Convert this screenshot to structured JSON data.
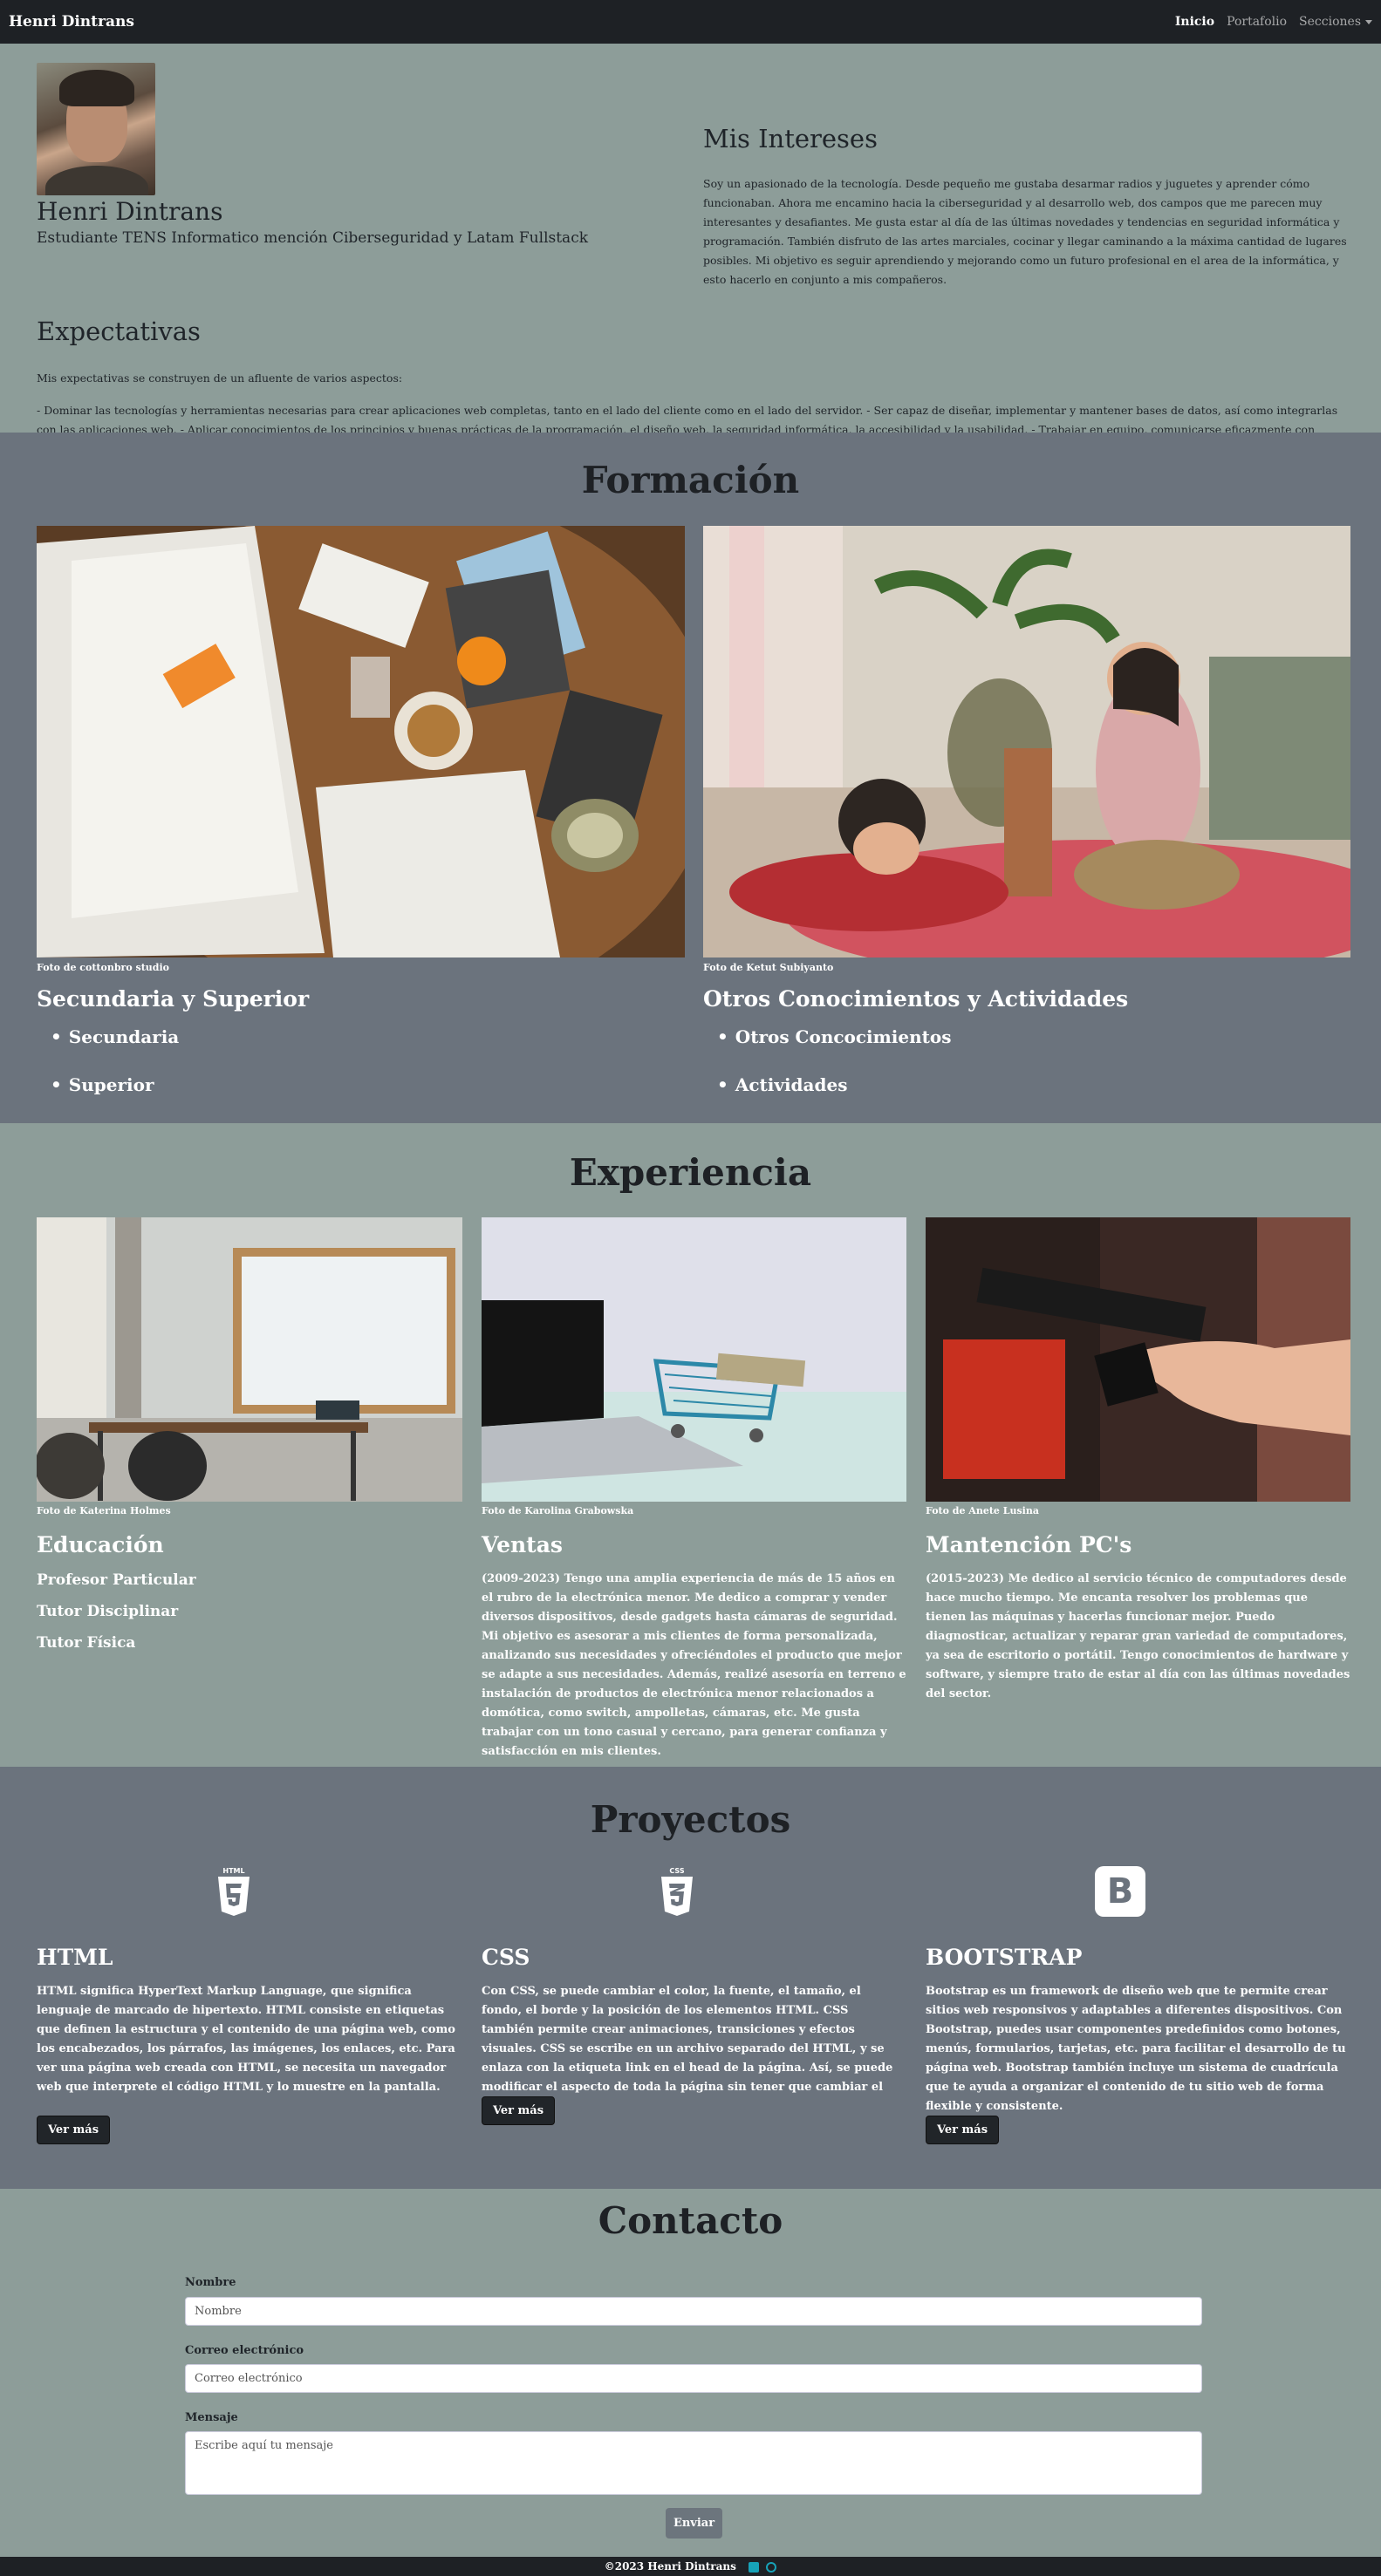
{
  "nav": {
    "brand": "Henri Dintrans",
    "links": [
      {
        "label": "Inicio",
        "active": true
      },
      {
        "label": "Portafolio",
        "active": false
      },
      {
        "label": "Secciones",
        "active": false
      }
    ]
  },
  "about": {
    "name": "Henri Dintrans",
    "subtitle": "Estudiante TENS Informatico mención Ciberseguridad y Latam Fullstack",
    "expect_title": "Expectativas",
    "expect_intro": "Mis expectativas se construyen de un afluente de varios aspectos:",
    "expect_body": "- Dominar las tecnologías y herramientas necesarias para crear aplicaciones web completas, tanto en el lado del cliente como en el lado del servidor. - Ser capaz de diseñar, implementar y mantener bases de datos, así como integrarlas con las aplicaciones web. - Aplicar conocimientos de los principios y buenas prácticas de la programación, el diseño web, la seguridad informática, la accesibilidad y la usabilidad. - Trabajar en equipo, comunicarse eficazmente con otros desarrolladores y clientes, y adaptarse a los cambios y requerimientos del proyecto. - Estar al día de las tendencias, novedades y oportunidades del sector, así como de las necesidades y preferencias de los usuarios.",
    "interests_title": "Mis Intereses",
    "interests_body": "Soy un apasionado de la tecnología. Desde pequeño me gustaba desarmar radios y juguetes y aprender cómo funcionaban. Ahora me encamino hacia la ciberseguridad y al desarrollo web, dos campos que me parecen muy interesantes y desafiantes. Me gusta estar al día de las últimas novedades y tendencias en seguridad informática y programación. También disfruto de las artes marciales, cocinar y llegar caminando a la máxima cantidad de lugares posibles. Mi objetivo es seguir aprendiendo y mejorando como un futuro profesional en el area de la informática, y esto hacerlo en conjunto a mis compañeros."
  },
  "formacion": {
    "title": "Formación",
    "cards": [
      {
        "credit": "Foto de cottonbro studio",
        "title": "Secundaria y Superior",
        "items": [
          "Secundaria",
          "Superior"
        ]
      },
      {
        "credit": "Foto de Ketut Subiyanto",
        "title": "Otros Conocimientos y Actividades",
        "items": [
          "Otros Concocimientos",
          "Actividades"
        ]
      }
    ]
  },
  "experiencia": {
    "title": "Experiencia",
    "cards": [
      {
        "credit": "Foto de Katerina Holmes",
        "title": "Educación",
        "items": [
          "Profesor Particular",
          "Tutor Disciplinar",
          "Tutor Física"
        ]
      },
      {
        "credit": "Foto de Karolina Grabowska",
        "title": "Ventas",
        "body": "(2009-2023) Tengo una amplia experiencia de más de 15 años en el rubro de la electrónica menor. Me dedico a comprar y vender diversos dispositivos, desde gadgets hasta cámaras de seguridad. Mi objetivo es asesorar a mis clientes de forma personalizada, analizando sus necesidades y ofreciéndoles el producto que mejor se adapte a sus necesidades. Además, realizé asesoría en terreno e instalación de productos de electrónica menor relacionados a domótica, como switch, ampolletas, cámaras, etc. Me gusta trabajar con un tono casual y cercano, para generar confianza y satisfacción en mis clientes."
      },
      {
        "credit": "Foto de Anete Lusina",
        "title": "Mantención PC's",
        "body": "(2015-2023) Me dedico al servicio técnico de computadores desde hace mucho tiempo. Me encanta resolver los problemas que tienen las máquinas y hacerlas funcionar mejor. Puedo diagnosticar, actualizar y reparar gran variedad de computadores, ya sea de escritorio o portátil. Tengo conocimientos de hardware y software, y siempre trato de estar al día con las últimas novedades del sector."
      }
    ]
  },
  "proyectos": {
    "title": "Proyectos",
    "button_label": "Ver más",
    "cards": [
      {
        "icon": "html5-icon",
        "badge": "HTML",
        "title": "HTML",
        "body": "HTML significa HyperText Markup Language, que significa lenguaje de marcado de hipertexto. HTML consiste en etiquetas que definen la estructura y el contenido de una página web, como los encabezados, los párrafos, las imágenes, los enlaces, etc. Para ver una página web creada con HTML, se necesita un navegador web que interprete el código HTML y lo muestre en la pantalla."
      },
      {
        "icon": "css3-icon",
        "badge": "CSS",
        "title": "CSS",
        "body": "Con CSS, se puede cambiar el color, la fuente, el tamaño, el fondo, el borde y la posición de los elementos HTML. CSS también permite crear animaciones, transiciones y efectos visuales. CSS se escribe en un archivo separado del HTML, y se enlaza con la etiqueta link en el head de la página. Así, se puede modificar el aspecto de toda la página sin tener que cambiar el HTML."
      },
      {
        "icon": "bootstrap-icon",
        "badge": "B",
        "title": "BOOTSTRAP",
        "body": "Bootstrap es un framework de diseño web que te permite crear sitios web responsivos y adaptables a diferentes dispositivos. Con Bootstrap, puedes usar componentes predefinidos como botones, menús, formularios, tarjetas, etc. para facilitar el desarrollo de tu página web. Bootstrap también incluye un sistema de cuadrícula que te ayuda a organizar el contenido de tu sitio web de forma flexible y consistente."
      }
    ]
  },
  "contacto": {
    "title": "Contacto",
    "name_label": "Nombre",
    "name_placeholder": "Nombre",
    "email_label": "Correo electrónico",
    "email_placeholder": "Correo electrónico",
    "message_label": "Mensaje",
    "message_placeholder": "Escribe aquí tu mensaje",
    "submit_label": "Enviar"
  },
  "footer": {
    "text": "©2023 Henri Dintrans"
  }
}
